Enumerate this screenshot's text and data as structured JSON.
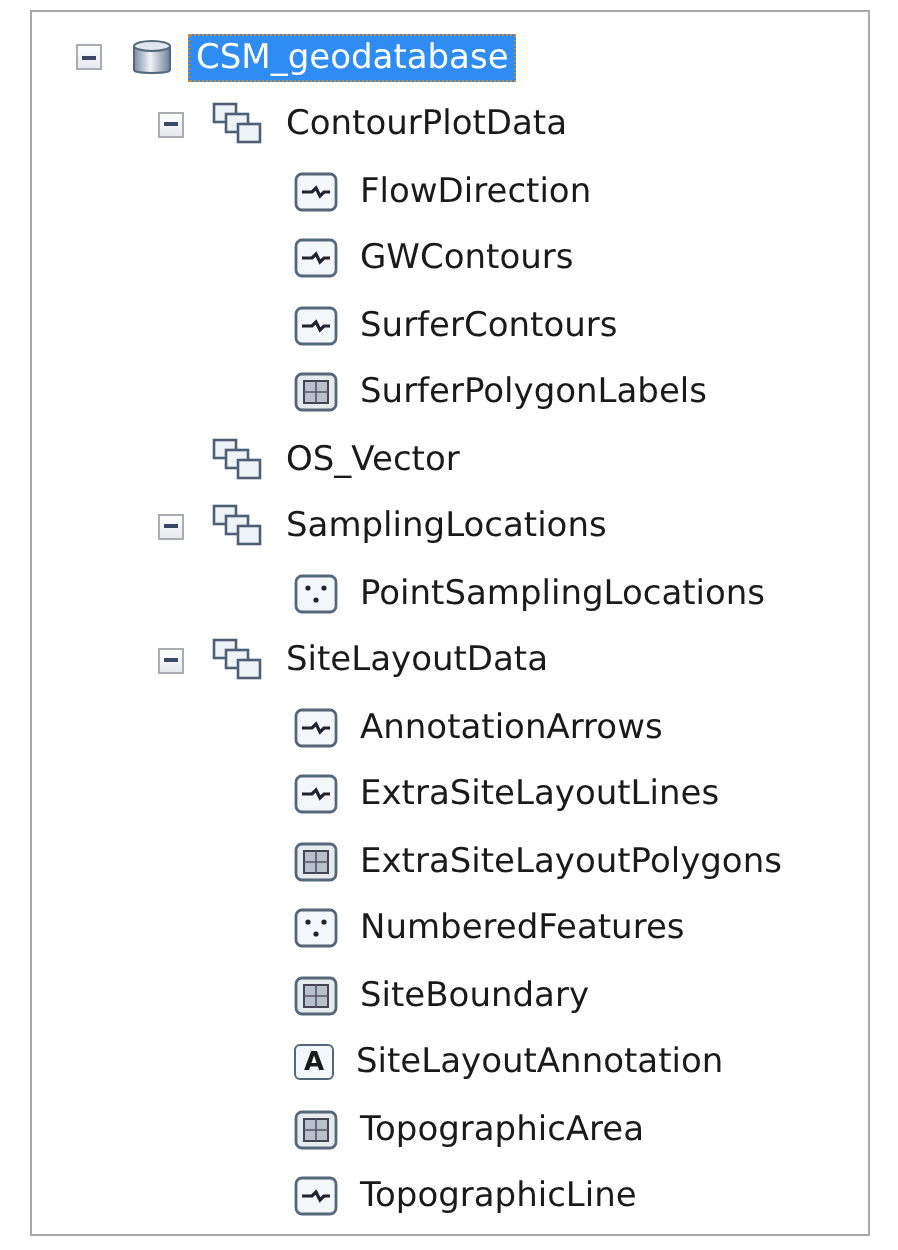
{
  "tree": {
    "label": "CSM_geodatabase",
    "kind": "geodatabase",
    "selected": true,
    "expanded": true,
    "children": [
      {
        "label": "ContourPlotData",
        "kind": "dataset",
        "selected": false,
        "expanded": true,
        "children": [
          {
            "label": "FlowDirection",
            "kind": "line",
            "selected": false
          },
          {
            "label": "GWContours",
            "kind": "line",
            "selected": false
          },
          {
            "label": "SurferContours",
            "kind": "line",
            "selected": false
          },
          {
            "label": "SurferPolygonLabels",
            "kind": "polygon",
            "selected": false
          }
        ]
      },
      {
        "label": "OS_Vector",
        "kind": "dataset",
        "selected": false
      },
      {
        "label": "SamplingLocations",
        "kind": "dataset",
        "selected": false,
        "expanded": true,
        "children": [
          {
            "label": "PointSamplingLocations",
            "kind": "point",
            "selected": false
          }
        ]
      },
      {
        "label": "SiteLayoutData",
        "kind": "dataset",
        "selected": false,
        "expanded": true,
        "children": [
          {
            "label": "AnnotationArrows",
            "kind": "line",
            "selected": false
          },
          {
            "label": "ExtraSiteLayoutLines",
            "kind": "line",
            "selected": false
          },
          {
            "label": "ExtraSiteLayoutPolygons",
            "kind": "polygon",
            "selected": false
          },
          {
            "label": "NumberedFeatures",
            "kind": "point",
            "selected": false
          },
          {
            "label": "SiteBoundary",
            "kind": "polygon",
            "selected": false
          },
          {
            "label": "SiteLayoutAnnotation",
            "kind": "annotation",
            "icon_glyph": "A",
            "selected": false
          },
          {
            "label": "TopographicArea",
            "kind": "polygon",
            "selected": false
          },
          {
            "label": "TopographicLine",
            "kind": "line",
            "selected": false
          }
        ]
      }
    ]
  }
}
